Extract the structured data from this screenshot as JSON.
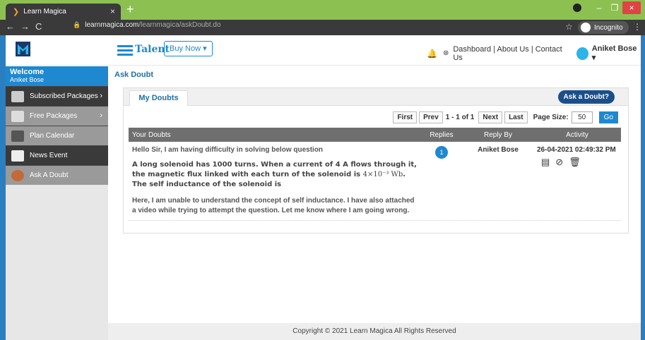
{
  "browser": {
    "tab_title": "Learn Magica",
    "tab_close": "×",
    "new_tab": "+",
    "url_domain": "learnmagica.com",
    "url_path": "/learnmagica/askDoubt.do",
    "incognito_label": "Incognito",
    "window_controls": {
      "minimize": "–",
      "maximize": "❐",
      "close": "×"
    }
  },
  "header": {
    "brand": "Talent",
    "buy_now": "Buy Now ▾",
    "links": "Dashboard | About Us | Contact Us",
    "user_name": "Aniket Bose ▾"
  },
  "sidebar": {
    "welcome": "Welcome",
    "user": "Aniket Bose",
    "items": [
      {
        "label": "Subscribed Packages",
        "chevron": "›"
      },
      {
        "label": "Free Packages",
        "chevron": "›"
      },
      {
        "label": "Plan Calendar",
        "chevron": ""
      },
      {
        "label": "News Event",
        "chevron": ""
      },
      {
        "label": "Ask A Doubt",
        "chevron": ""
      }
    ]
  },
  "main": {
    "breadcrumb": "Ask Doubt",
    "tab_label": "My Doubts",
    "ask_button": "Ask a Doubt?",
    "pager": {
      "first": "First",
      "prev": "Prev",
      "info": "1 - 1 of 1",
      "next": "Next",
      "last": "Last",
      "page_size_label": "Page Size:",
      "page_size": "50",
      "go": "Go"
    },
    "columns": [
      "Your Doubts",
      "Replies",
      "Reply By",
      "Activity"
    ],
    "rows": [
      {
        "intro": "Hello Sir, I am having difficulty in solving below question",
        "question_a": "A long solenoid has 1000 turns. When a current of 4 A flows through it, the magnetic flux linked with each turn of the solenoid is",
        "question_math": "4×10⁻³ Wb",
        "question_b": ". The self inductance of the solenoid is",
        "note": "Here, I am unable to understand the concept of self inductance. I have also attached a video while trying to attempt the question. Let me know where I am going wrong.",
        "replies": "1",
        "reply_by": "Aniket Bose",
        "activity": "26-04-2021 02:49:32 PM"
      }
    ]
  },
  "footer": "Copyright © 2021 Learn Magica All Rights Reserved",
  "colors": {
    "accent": "#1e88d0",
    "chrome_green": "#8cc152",
    "sidebar_dark": "#3a3a3a"
  }
}
